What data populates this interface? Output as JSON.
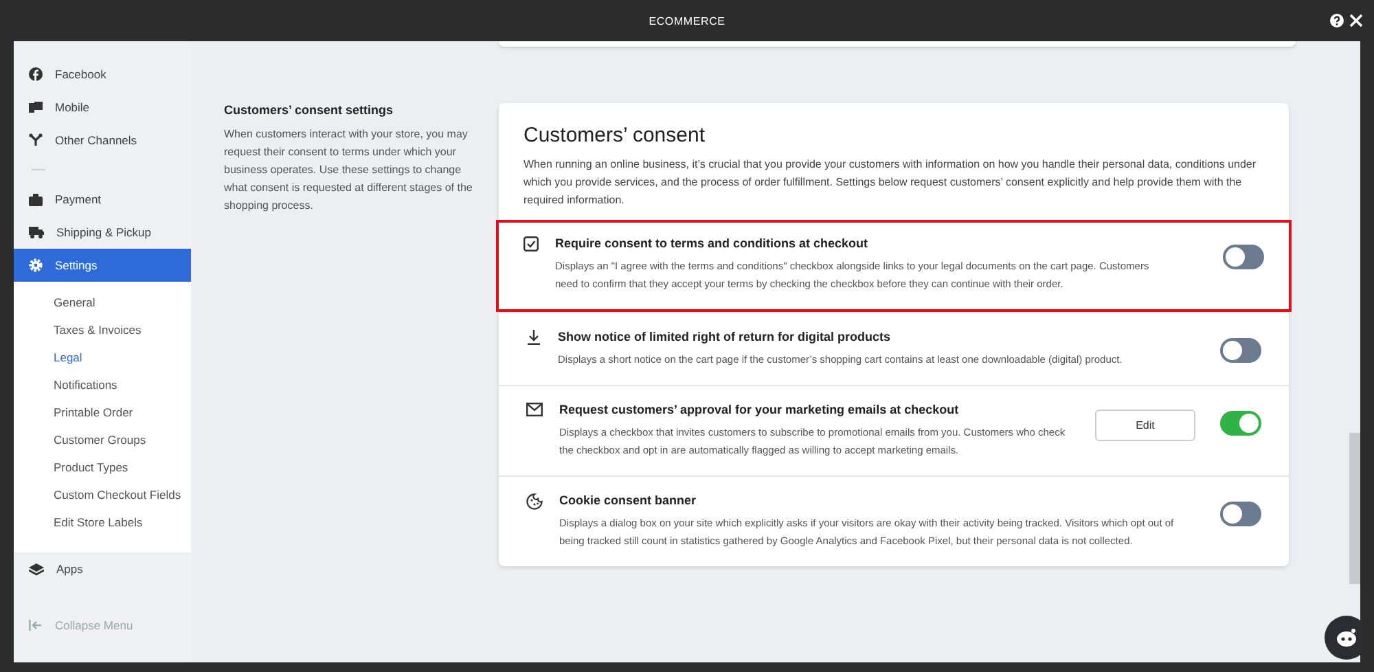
{
  "window": {
    "title": "ECOMMERCE"
  },
  "sidebar": {
    "items": [
      {
        "label": "Facebook",
        "selected": false
      },
      {
        "label": "Mobile",
        "selected": false
      },
      {
        "label": "Other Channels",
        "selected": false
      },
      {
        "kind": "divider"
      },
      {
        "label": "Payment",
        "selected": false
      },
      {
        "label": "Shipping & Pickup",
        "selected": false
      },
      {
        "label": "Settings",
        "selected": true,
        "children": [
          {
            "label": "General",
            "selected": false
          },
          {
            "label": "Taxes & Invoices",
            "selected": false
          },
          {
            "label": "Legal",
            "selected": true
          },
          {
            "label": "Notifications",
            "selected": false
          },
          {
            "label": "Printable Order",
            "selected": false
          },
          {
            "label": "Customer Groups",
            "selected": false
          },
          {
            "label": "Product Types",
            "selected": false
          },
          {
            "label": "Custom Checkout Fields",
            "selected": false
          },
          {
            "label": "Edit Store Labels",
            "selected": false
          }
        ]
      },
      {
        "label": "Apps",
        "selected": false
      }
    ],
    "collapse": "Collapse Menu"
  },
  "intro": {
    "title": "Customers’ consent settings",
    "text": "When customers interact with your store, you may request their consent to terms under which your business operates. Use these settings to change what consent is requested at different stages of the shopping process."
  },
  "card": {
    "title": "Customers’ consent",
    "text": "When running an online business, it’s crucial that you provide your customers with information on how you handle their personal data, conditions under which you provide services, and the process of order fulfillment. Settings below request customers’ consent explicitly and help provide them with the required information.",
    "rows": [
      {
        "title": "Require consent to terms and conditions at checkout",
        "text": "Displays an \"I agree with the terms and conditions\" checkbox alongside links to your legal documents on the cart page. Customers need to confirm that they accept your terms by checking the checkbox before they can continue with their order.",
        "on": false,
        "highlighted": true
      },
      {
        "title": "Show notice of limited right of return for digital products",
        "text": "Displays a short notice on the cart page if the customer’s shopping cart contains at least one downloadable (digital) product.",
        "on": false,
        "highlighted": false
      },
      {
        "title": "Request customers’ approval for your marketing emails at checkout",
        "text": "Displays a checkbox that invites customers to subscribe to promotional emails from you. Customers who check the checkbox and opt in are automatically flagged as willing to accept marketing emails.",
        "on": true,
        "highlighted": false,
        "button": "Edit"
      },
      {
        "title": "Cookie consent banner",
        "text": "Displays a dialog box on your site which explicitly asks if your visitors are okay with their activity being tracked. Visitors which opt out of being tracked still count in statistics gathered by Google Analytics and Facebook Pixel, but their personal data is not collected.",
        "on": false,
        "highlighted": false
      }
    ]
  }
}
